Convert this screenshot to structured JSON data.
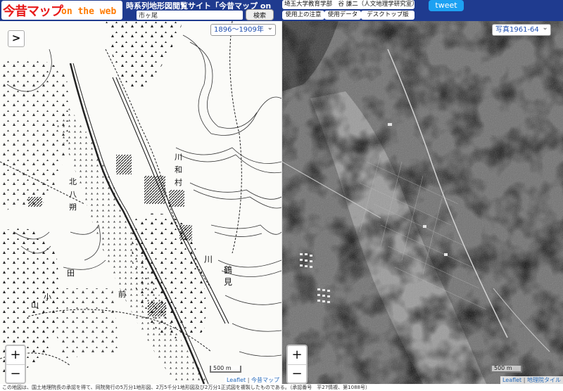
{
  "header": {
    "logo_main": "今昔マップ",
    "logo_sub": "on the web",
    "site_title": "時系列地形図閲覧サイト「今昔マップ on the web」",
    "search_value": "市ヶ尾",
    "search_button": "検索",
    "links": {
      "university": "埼玉大学教育学部　谷 謙二（人文地理学研究室）",
      "usage_notes": "使用上の注意",
      "data": "使用データ",
      "desktop": "デスクトップ版"
    },
    "tweet": "tweet"
  },
  "left_map": {
    "era_select": "1896～1909年",
    "expand": ">",
    "zoom_in": "+",
    "zoom_out": "−",
    "scale": "500 m",
    "attr_leaflet": "Leaflet",
    "attr_source": "今昔マップ",
    "place_labels": [
      "川",
      "和",
      "村",
      "鶴",
      "見",
      "川",
      "北",
      "八",
      "朔",
      "山",
      "小",
      "前",
      "田"
    ]
  },
  "right_map": {
    "era_select": "写真1961-64",
    "zoom_in": "+",
    "zoom_out": "−",
    "scale": "500 m",
    "attr_leaflet": "Leaflet",
    "attr_source": "地理院タイル"
  },
  "footer": {
    "text": "この地図は、国土地理院長の承認を得て、同院発行の5万分1地形図、2万5千分1地形図及び2万分1正式図を複製したものである。（承認番号　平27情複、第1088号）"
  }
}
